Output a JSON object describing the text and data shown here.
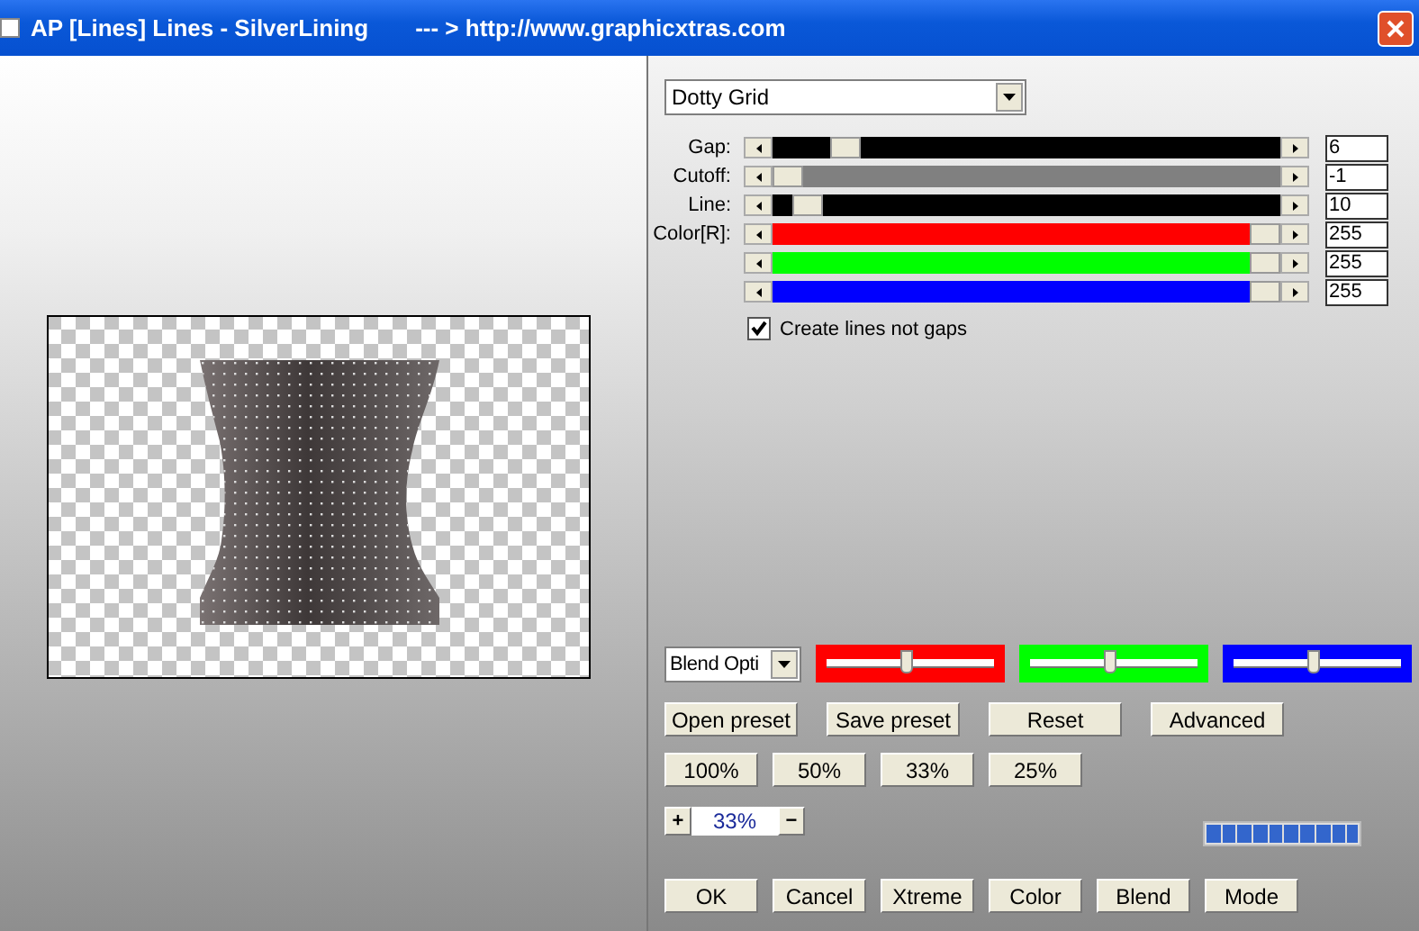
{
  "window": {
    "title": "AP [Lines]  Lines - SilverLining",
    "subtitle": "--- > http://www.graphicxtras.com"
  },
  "pattern_select": {
    "value": "Dotty Grid"
  },
  "sliders": [
    {
      "label": "Gap:",
      "value": "6",
      "level": 0.12,
      "color": "#000000"
    },
    {
      "label": "Cutoff:",
      "value": "-1",
      "level": 0,
      "color": "#808080"
    },
    {
      "label": "Line:",
      "value": "10",
      "level": 0.04,
      "color": "#000000"
    },
    {
      "label": "Color[R]:",
      "value": "255",
      "level": 1,
      "color": "#ff0000"
    },
    {
      "value": "255",
      "level": 1,
      "color": "#00ff00"
    },
    {
      "value": "255",
      "level": 1,
      "color": "#0000ff"
    }
  ],
  "create_lines_checkbox": {
    "label": "Create lines not gaps",
    "checked": true
  },
  "blend_select": {
    "value": "Blend Opti"
  },
  "blend_sliders": [
    {
      "color": "#ff0000",
      "level": 0.48
    },
    {
      "color": "#00ff00",
      "level": 0.48
    },
    {
      "color": "#0000ff",
      "level": 0.48
    }
  ],
  "preset_buttons": [
    "Open preset",
    "Save preset",
    "Reset",
    "Advanced"
  ],
  "zoom_buttons": [
    "100%",
    "50%",
    "33%",
    "25%"
  ],
  "zoom_stepper": {
    "plus": "+",
    "value": "33%",
    "minus": "−"
  },
  "progress": {
    "level": 1
  },
  "action_buttons": [
    "OK",
    "Cancel",
    "Xtreme",
    "Color",
    "Blend",
    "Mode"
  ]
}
